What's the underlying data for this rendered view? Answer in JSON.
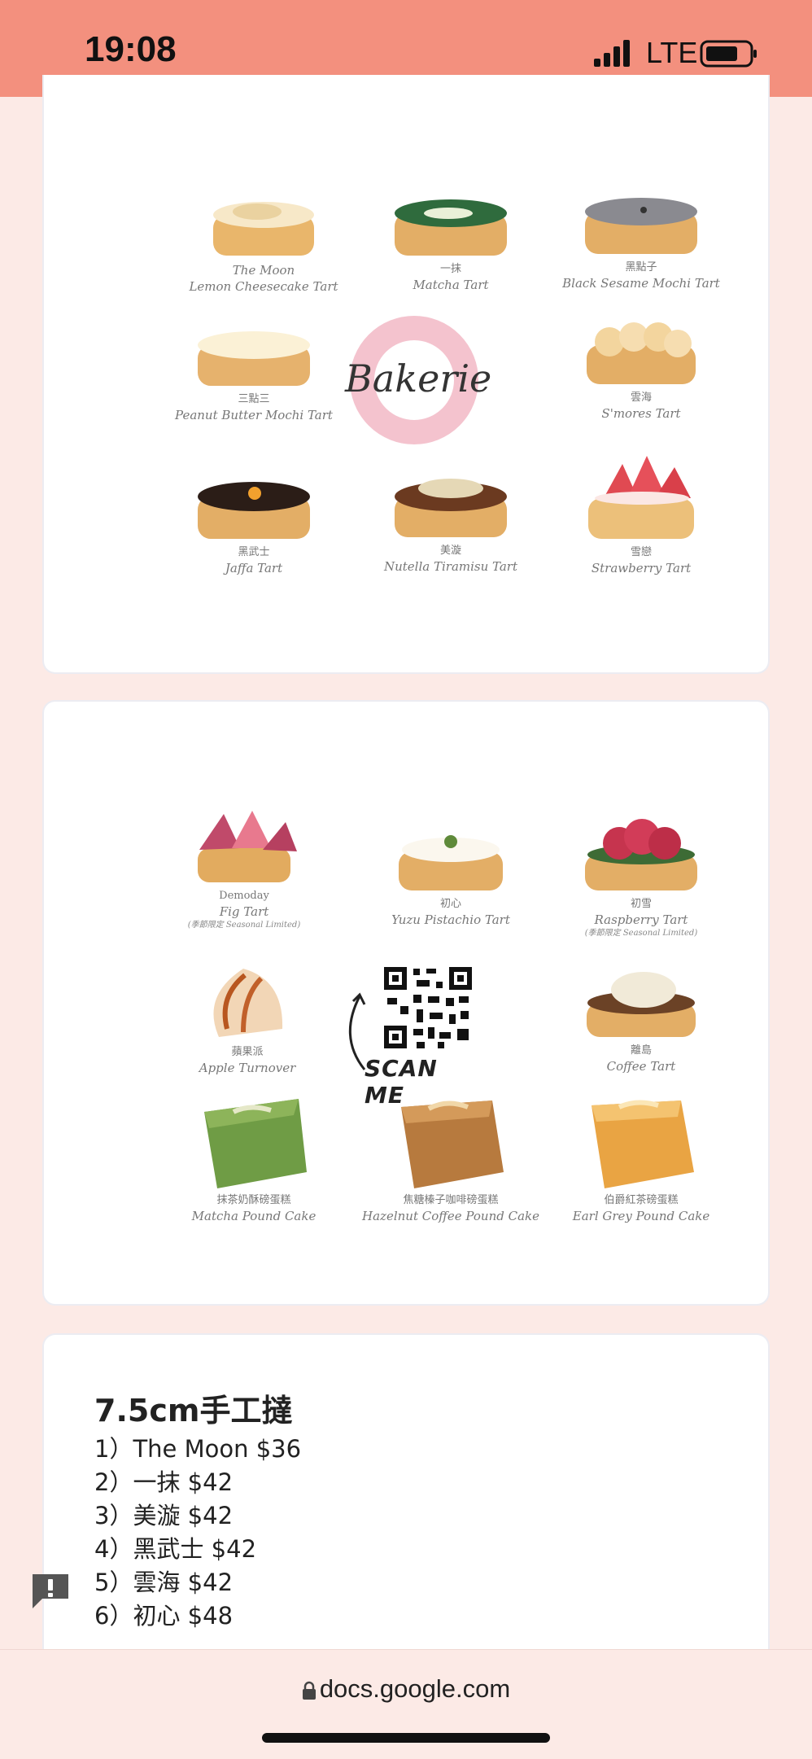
{
  "status_bar": {
    "time": "19:08",
    "network": "LTE"
  },
  "menu1": {
    "tiles": [
      {
        "cn": "",
        "en": "The Moon",
        "en2": "Lemon Cheesecake Tart"
      },
      {
        "cn": "一抹",
        "en": "Matcha Tart"
      },
      {
        "cn": "黑點子",
        "en": "Black Sesame Mochi Tart"
      },
      {
        "cn": "三點三",
        "en": "Peanut Butter Mochi Tart"
      },
      {
        "cn": "雲海",
        "en": "S'mores Tart"
      },
      {
        "cn": "黑武士",
        "en": "Jaffa Tart"
      },
      {
        "cn": "美漩",
        "en": "Nutella Tiramisu Tart"
      },
      {
        "cn": "雪戀",
        "en": "Strawberry Tart"
      }
    ],
    "logo_text": "Bakerie"
  },
  "menu2": {
    "tiles": [
      {
        "cn": "Demoday",
        "en": "Fig Tart",
        "note": "(季節限定 Seasonal Limited)"
      },
      {
        "cn": "初心",
        "en": "Yuzu Pistachio Tart",
        "note": ""
      },
      {
        "cn": "初雪",
        "en": "Raspberry Tart",
        "note": "(季節限定 Seasonal Limited)"
      },
      {
        "cn": "蘋果派",
        "en": "Apple Turnover",
        "note": ""
      },
      {
        "cn": "離島",
        "en": "Coffee Tart",
        "note": ""
      },
      {
        "cn": "抹茶奶酥磅蛋糕",
        "en": "Matcha Pound Cake",
        "note": ""
      },
      {
        "cn": "焦糖榛子咖啡磅蛋糕",
        "en": "Hazelnut Coffee Pound Cake",
        "note": ""
      },
      {
        "cn": "伯爵紅茶磅蛋糕",
        "en": "Earl Grey Pound Cake",
        "note": ""
      }
    ],
    "scan_text": "SCAN ME"
  },
  "prices": {
    "title": "7.5cm手工撻",
    "items": [
      "1）The Moon $36",
      "2）一抹 $42",
      "3）美漩 $42",
      "4）黑武士 $42",
      "5）雲海 $42",
      "6）初心 $48"
    ]
  },
  "browser": {
    "url": "docs.google.com"
  },
  "colors": {
    "status_bar": "#f3907e",
    "page_bg": "#fceae6",
    "logo_swirl": "#f2b8c6"
  }
}
